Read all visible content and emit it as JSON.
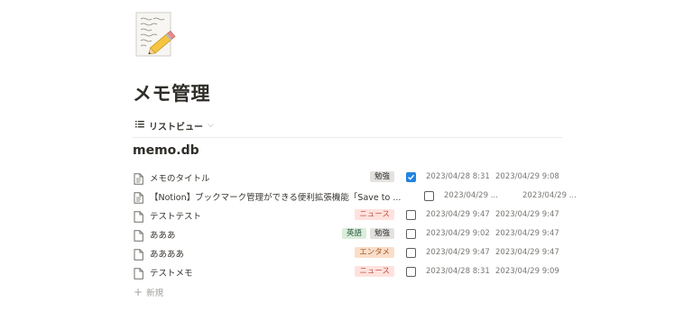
{
  "page": {
    "icon": "memo-pencil-icon",
    "title": "メモ管理"
  },
  "view_tab": {
    "icon": "list-view-icon",
    "label": "リストビュー",
    "chevron": "⌵"
  },
  "database": {
    "title": "memo.db"
  },
  "colors": {
    "checkbox_checked": "#2383e2",
    "tag_gray": "#e3e2e0",
    "tag_red": "#ffe2dd",
    "tag_green": "#dbeddb",
    "tag_orange": "#fadec9"
  },
  "rows": [
    {
      "icon": "page-text-icon",
      "name": "メモのタイトル",
      "tags": [
        {
          "label": "勉強",
          "color": "gray"
        }
      ],
      "checked": true,
      "created": "2023/04/28 8:31",
      "edited": "2023/04/29 9:08"
    },
    {
      "icon": "page-text-icon",
      "name": "【Notion】ブックマーク管理ができる便利拡張機能「Save to ...",
      "tags": [],
      "checked": false,
      "created": "2023/04/29 ...",
      "edited": "2023/04/29 ..."
    },
    {
      "icon": "page-icon",
      "name": "テストテスト",
      "tags": [
        {
          "label": "ニュース",
          "color": "red"
        }
      ],
      "checked": false,
      "created": "2023/04/29 9:47",
      "edited": "2023/04/29 9:47"
    },
    {
      "icon": "page-icon",
      "name": "あああ",
      "tags": [
        {
          "label": "英語",
          "color": "green"
        },
        {
          "label": "勉強",
          "color": "gray"
        }
      ],
      "checked": false,
      "created": "2023/04/29 9:02",
      "edited": "2023/04/29 9:47"
    },
    {
      "icon": "page-icon",
      "name": "ああああ",
      "tags": [
        {
          "label": "エンタメ",
          "color": "orange"
        }
      ],
      "checked": false,
      "created": "2023/04/29 9:47",
      "edited": "2023/04/29 9:47"
    },
    {
      "icon": "page-icon",
      "name": "テストメモ",
      "tags": [
        {
          "label": "ニュース",
          "color": "red"
        }
      ],
      "checked": false,
      "created": "2023/04/28 8:31",
      "edited": "2023/04/29 9:09"
    }
  ],
  "new_item": {
    "icon": "plus-icon",
    "label": "新規"
  }
}
